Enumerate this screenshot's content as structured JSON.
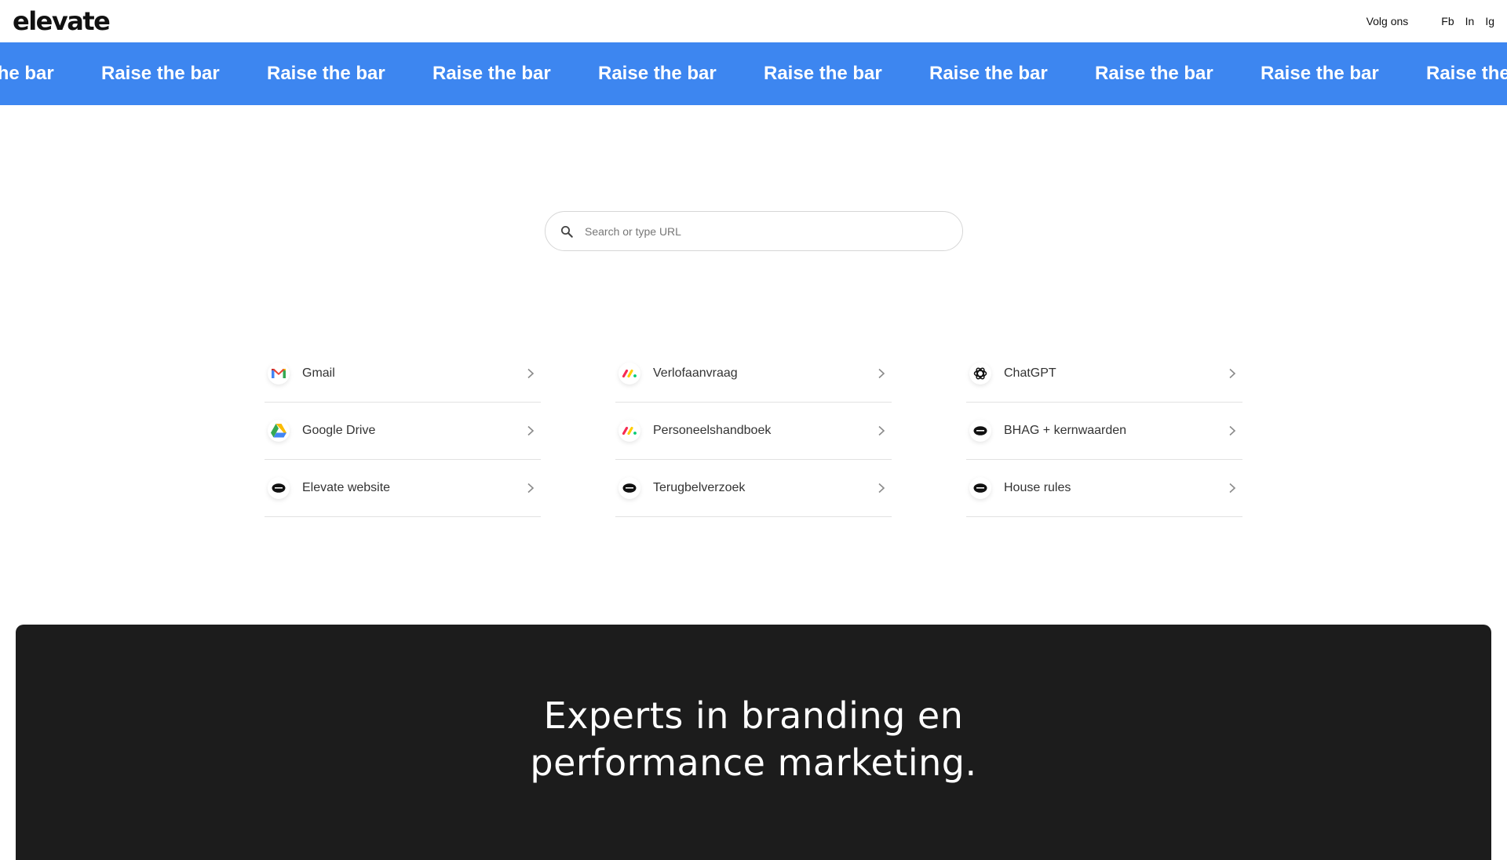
{
  "header": {
    "logo": "elevate",
    "follow_label": "Volg ons",
    "social": [
      "Fb",
      "In",
      "Ig"
    ]
  },
  "marquee": {
    "text": "Raise the bar",
    "color": "#3d86f0"
  },
  "search": {
    "placeholder": "Search or type URL",
    "value": ""
  },
  "links": {
    "col1": [
      {
        "label": "Gmail",
        "icon": "gmail-icon"
      },
      {
        "label": "Google Drive",
        "icon": "google-drive-icon"
      },
      {
        "label": "Elevate website",
        "icon": "elevate-icon"
      }
    ],
    "col2": [
      {
        "label": "Verlofaanvraag",
        "icon": "monday-icon"
      },
      {
        "label": "Personeelshandboek",
        "icon": "monday-icon"
      },
      {
        "label": "Terugbelverzoek",
        "icon": "elevate-icon"
      }
    ],
    "col3": [
      {
        "label": "ChatGPT",
        "icon": "chatgpt-icon"
      },
      {
        "label": "BHAG + kernwaarden",
        "icon": "elevate-icon"
      },
      {
        "label": "House rules",
        "icon": "elevate-icon"
      }
    ]
  },
  "hero": {
    "line1": "Experts in branding en",
    "line2": "performance marketing."
  }
}
